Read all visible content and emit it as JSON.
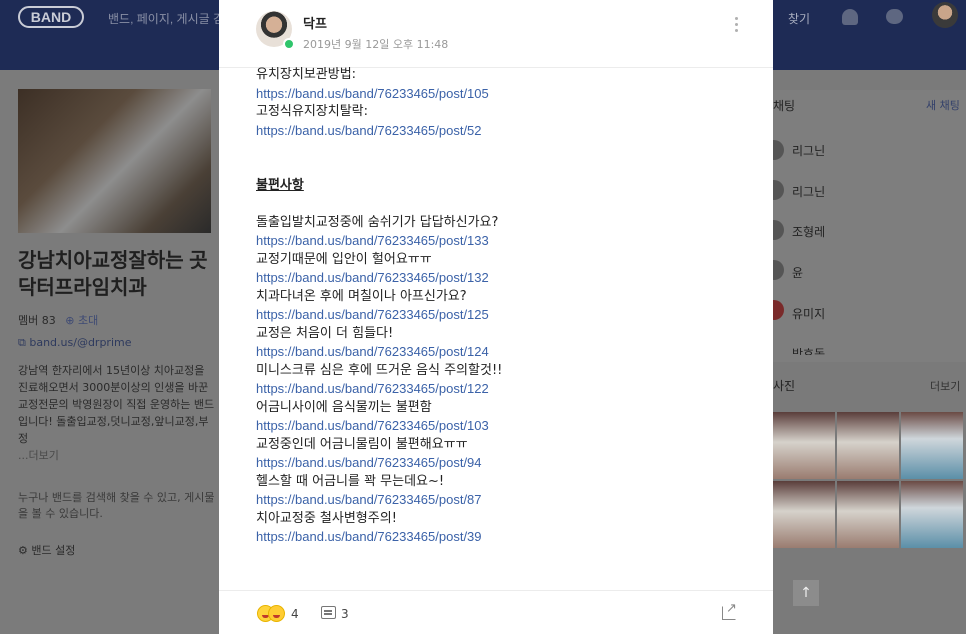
{
  "background": {
    "logo": "BAND",
    "search_placeholder": "밴드, 페이지, 게시글 검",
    "find_label": "찾기",
    "band_title": "강남치아교정잘하는 곳 닥터프라임치과",
    "member_label": "멤버 83",
    "invite_label": "초대",
    "band_url": "band.us/@drprime",
    "description": "강남역 한자리에서 15년이상 치아교정을 진료해오면서 3000분이상의 인생을 바꾼 교정전문의 박영원장이 직접 운영하는 밴드입니다! 돌출입교정,덧니교정,앞니교정,부정",
    "more_label": "...더보기",
    "notice": "누구나 밴드를 검색해 찾을 수 있고, 게시물을 볼 수 있습니다.",
    "settings_label": "밴드 설정",
    "chat_title": "채팅",
    "new_chat_label": "새 채팅",
    "chat_items": [
      "리그닌",
      "리그닌",
      "조형레",
      "윤",
      "유미지",
      "박효동"
    ],
    "photo_title": "사진",
    "photo_more": "더보기"
  },
  "post": {
    "author": "닥프",
    "date": "2019년 9월 12일 오후 11:48",
    "top_lines": [
      {
        "text": "유치장치보관방법:",
        "link": "https://band.us/band/76233465/post/105"
      },
      {
        "text": "고정식유지장치탈락:",
        "link": "https://band.us/band/76233465/post/52"
      }
    ],
    "heading": "불편사항",
    "items": [
      {
        "text": "돌출입발치교정중에 숨쉬기가 답답하신가요?",
        "link": "https://band.us/band/76233465/post/133"
      },
      {
        "text": "교정기때문에 입안이 헐어요ㅠㅠ",
        "link": "https://band.us/band/76233465/post/132"
      },
      {
        "text": "치과다녀온 후에 며칠이나 아프신가요?",
        "link": "https://band.us/band/76233465/post/125"
      },
      {
        "text": "교정은 처음이 더 힘들다!",
        "link": "https://band.us/band/76233465/post/124"
      },
      {
        "text": "미니스크류 심은 후에 뜨거운 음식 주의할것!!",
        "link": "https://band.us/band/76233465/post/122"
      },
      {
        "text": "어금니사이에 음식물끼는 불편함",
        "link": "https://band.us/band/76233465/post/103"
      },
      {
        "text": "교정중인데 어금니물림이 불편해요ㅠㅠ",
        "link": "https://band.us/band/76233465/post/94"
      },
      {
        "text": "헬스할 때 어금니를 꽉 무는데요~!",
        "link": "https://band.us/band/76233465/post/87"
      },
      {
        "text": "치아교정중 철사변형주의!",
        "link": "https://band.us/band/76233465/post/39"
      }
    ],
    "emotion_count": "4",
    "comment_count": "3"
  },
  "colors": {
    "link": "#3b62a8",
    "header_bg": "#1e2b55",
    "badge": "#2fc56b"
  }
}
